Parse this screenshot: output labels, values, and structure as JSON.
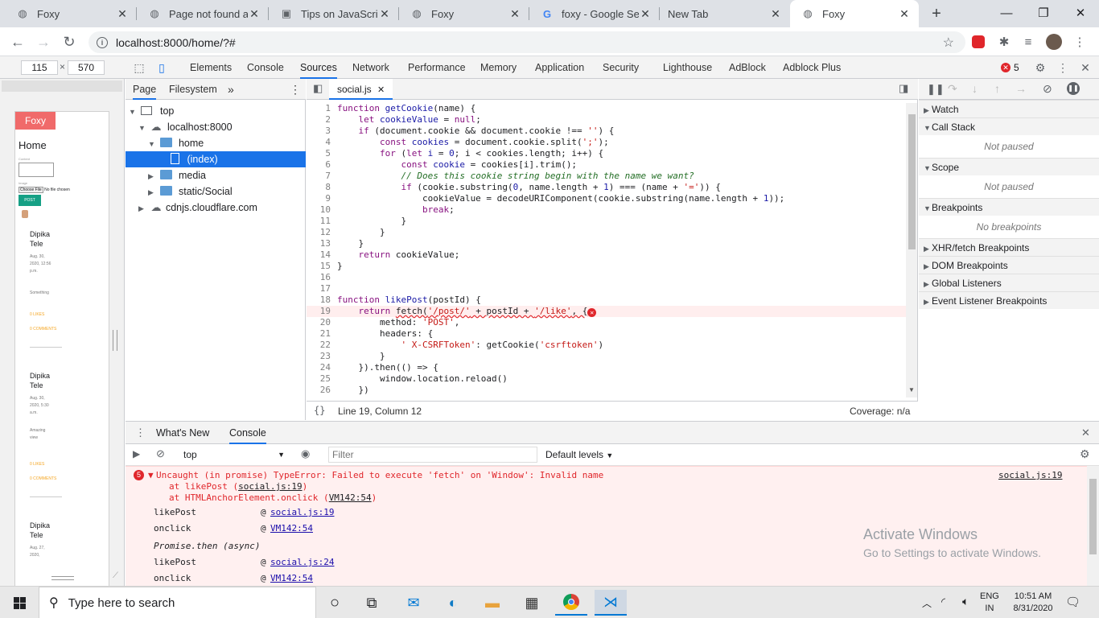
{
  "tabs": [
    {
      "title": "Foxy",
      "icon": "globe-icon"
    },
    {
      "title": "Page not found at",
      "icon": "globe-icon"
    },
    {
      "title": "Tips on JavaScript",
      "icon": "doc-icon"
    },
    {
      "title": "Foxy",
      "icon": "globe-icon"
    },
    {
      "title": "foxy - Google Sear",
      "icon": "google-icon"
    },
    {
      "title": "New Tab",
      "icon": ""
    },
    {
      "title": "Foxy",
      "icon": "globe-icon"
    }
  ],
  "address": {
    "url": "localhost:8000/home/?#"
  },
  "devtools": {
    "width": "115",
    "height": "570",
    "times": "×",
    "tabs": [
      "Elements",
      "Console",
      "Sources",
      "Network",
      "Performance",
      "Memory",
      "Application",
      "Security",
      "Lighthouse",
      "AdBlock",
      "Adblock Plus"
    ],
    "error_count": "5"
  },
  "preview": {
    "brand": "Foxy",
    "heading": "Home",
    "content_label": "Content",
    "image_label": "Image",
    "choose_file": "Choose File",
    "no_file": "No file chosen",
    "post_btn": "POST",
    "posts": [
      {
        "author": "Dipika Tele",
        "meta": "Aug. 30, 2020, 12:56 p.m.",
        "text": "Something",
        "likes": "0 LIKES",
        "comments": "0 COMMENTS"
      },
      {
        "author": "Dipika Tele",
        "meta": "Aug. 30, 2020, 5:30 a.m.",
        "text": "Amazing view",
        "likes": "0 LIKES",
        "comments": "0 COMMENTS"
      },
      {
        "author": "Dipika Tele",
        "meta": "Aug. 27, 2020,",
        "text": "",
        "likes": "",
        "comments": ""
      }
    ]
  },
  "navigator": {
    "tabs": [
      "Page",
      "Filesystem"
    ],
    "more": "»",
    "tree": [
      {
        "label": "top",
        "depth": 0
      },
      {
        "label": "localhost:8000",
        "depth": 1
      },
      {
        "label": "home",
        "depth": 2
      },
      {
        "label": "(index)",
        "depth": 3
      },
      {
        "label": "media",
        "depth": 2
      },
      {
        "label": "static/Social",
        "depth": 2
      },
      {
        "label": "cdnjs.cloudflare.com",
        "depth": 1
      }
    ]
  },
  "editor": {
    "file": "social.js",
    "code": [
      "function getCookie(name) {",
      "    let cookieValue = null;",
      "    if (document.cookie && document.cookie !== '') {",
      "        const cookies = document.cookie.split(';');",
      "        for (let i = 0; i < cookies.length; i++) {",
      "            const cookie = cookies[i].trim();",
      "            // Does this cookie string begin with the name we want?",
      "            if (cookie.substring(0, name.length + 1) === (name + '=')) {",
      "                cookieValue = decodeURIComponent(cookie.substring(name.length + 1));",
      "                break;",
      "            }",
      "        }",
      "    }",
      "    return cookieValue;",
      "}",
      "",
      "",
      "function likePost(postId) {",
      "    return fetch('/post/' + postId + '/like', {",
      "        method: 'POST',",
      "        headers: {",
      "            ' X-CSRFToken': getCookie('csrftoken')",
      "        }",
      "    }).then(() => {",
      "        window.location.reload()",
      "    })"
    ],
    "status": "Line 19, Column 12",
    "coverage": "Coverage: n/a",
    "braces": "{}"
  },
  "debugger": {
    "sections": [
      "Watch",
      "Call Stack",
      "Scope",
      "Breakpoints",
      "XHR/fetch Breakpoints",
      "DOM Breakpoints",
      "Global Listeners",
      "Event Listener Breakpoints"
    ],
    "not_paused_1": "Not paused",
    "not_paused_2": "Not paused",
    "no_breakpoints": "No breakpoints"
  },
  "drawer": {
    "tabs": [
      "What's New",
      "Console"
    ],
    "context": "top",
    "filter_placeholder": "Filter",
    "levels": "Default levels",
    "error_badge": "5",
    "error_msg": "Uncaught (in promise) TypeError: Failed to execute 'fetch' on 'Window': Invalid name",
    "at1_prefix": "at likePost (",
    "at1_link": "social.js:19",
    "at1_suffix": ")",
    "at2_prefix": "at HTMLAnchorElement.onclick (",
    "at2_link": "VM142:54",
    "at2_suffix": ")",
    "source": "social.js:19",
    "stack": [
      {
        "fn": "likePost",
        "at": "@",
        "link": "social.js:19"
      },
      {
        "fn": "onclick",
        "at": "@",
        "link": "VM142:54"
      },
      {
        "fn": "Promise.then (async)",
        "at": "",
        "link": ""
      },
      {
        "fn": "likePost",
        "at": "@",
        "link": "social.js:24"
      },
      {
        "fn": "onclick",
        "at": "@",
        "link": "VM142:54"
      }
    ]
  },
  "watermark": {
    "title": "Activate Windows",
    "sub": "Go to Settings to activate Windows."
  },
  "taskbar": {
    "search": "Type here to search",
    "lang": "ENG",
    "region": "IN",
    "time": "10:51 AM",
    "date": "8/31/2020"
  }
}
